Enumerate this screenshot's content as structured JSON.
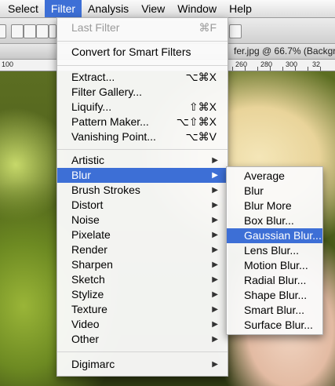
{
  "menubar": {
    "items": [
      "Select",
      "Filter",
      "Analysis",
      "View",
      "Window",
      "Help"
    ],
    "active": "Filter"
  },
  "document": {
    "title_fragment": "fer.jpg @ 66.7% (Backgr"
  },
  "ruler": {
    "labels": [
      "100",
      "260",
      "280",
      "300",
      "32"
    ]
  },
  "filter_menu": {
    "last_filter": {
      "label": "Last Filter",
      "shortcut": "⌘F"
    },
    "convert_smart": "Convert for Smart Filters",
    "extract": {
      "label": "Extract...",
      "shortcut": "⌥⌘X"
    },
    "filter_gallery": "Filter Gallery...",
    "liquify": {
      "label": "Liquify...",
      "shortcut": "⇧⌘X"
    },
    "pattern_maker": {
      "label": "Pattern Maker...",
      "shortcut": "⌥⇧⌘X"
    },
    "vanishing_point": {
      "label": "Vanishing Point...",
      "shortcut": "⌥⌘V"
    },
    "submenus": [
      "Artistic",
      "Blur",
      "Brush Strokes",
      "Distort",
      "Noise",
      "Pixelate",
      "Render",
      "Sharpen",
      "Sketch",
      "Stylize",
      "Texture",
      "Video",
      "Other"
    ],
    "highlighted": "Blur",
    "digimarc": "Digimarc"
  },
  "blur_menu": {
    "items": [
      "Average",
      "Blur",
      "Blur More",
      "Box Blur...",
      "Gaussian Blur...",
      "Lens Blur...",
      "Motion Blur...",
      "Radial Blur...",
      "Shape Blur...",
      "Smart Blur...",
      "Surface Blur..."
    ],
    "highlighted": "Gaussian Blur..."
  },
  "colors": {
    "highlight": "#3d6fd6"
  }
}
